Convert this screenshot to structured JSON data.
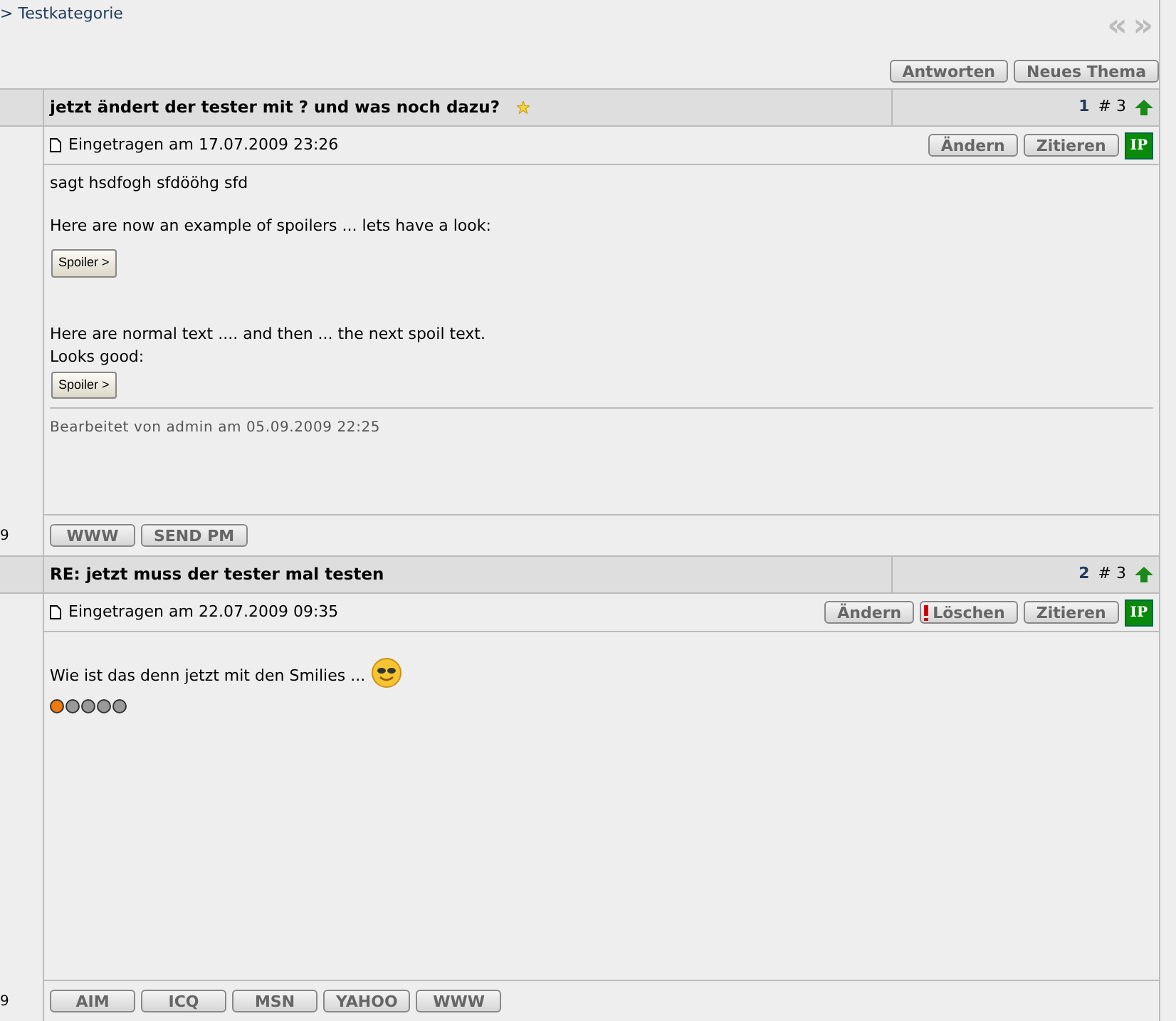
{
  "breadcrumb": "> Testkategorie",
  "nav_arrows": {
    "prev": "«",
    "next": "»"
  },
  "actions": [
    "Antworten",
    "Neues Thema"
  ],
  "posts": [
    {
      "title": "jetzt ändert der tester mit ? und was noch dazu?",
      "starred": true,
      "number": "1",
      "count": "# 3",
      "date": "Eingetragen am 17.07.2009 23:26",
      "author_fragment": "9",
      "buttons": [
        {
          "kind": "edit",
          "label": "Ändern"
        },
        {
          "kind": "quote",
          "label": "Zitieren"
        }
      ],
      "ip": "IP",
      "body": [
        {
          "kind": "text",
          "text": "sagt hsdfogh sfdööhg sfd"
        },
        {
          "kind": "gap"
        },
        {
          "kind": "text",
          "text": "Here are now an example of spoilers ... lets have a look:"
        },
        {
          "kind": "spoiler",
          "label": "Spoiler >"
        },
        {
          "kind": "gap"
        },
        {
          "kind": "gap"
        },
        {
          "kind": "text",
          "text": "Here are normal text .... and then ... the next spoil text."
        },
        {
          "kind": "text",
          "text": "Looks good:"
        },
        {
          "kind": "spoiler",
          "label": "Spoiler >"
        },
        {
          "kind": "edited",
          "text": "Bearbeitet von admin am 05.09.2009 22:25"
        }
      ],
      "contacts": [
        "WWW",
        "SEND PM"
      ]
    },
    {
      "title": "RE: jetzt muss der tester mal testen",
      "starred": false,
      "number": "2",
      "count": "# 3",
      "date": "Eingetragen am 22.07.2009 09:35",
      "author_fragment": "9",
      "buttons": [
        {
          "kind": "edit",
          "label": "Ändern"
        },
        {
          "kind": "delete",
          "label": "Löschen"
        },
        {
          "kind": "quote",
          "label": "Zitieren"
        }
      ],
      "ip": "IP",
      "body": [
        {
          "kind": "gap"
        },
        {
          "kind": "smiley_text",
          "text": "Wie ist das denn jetzt mit den Smilies ..."
        },
        {
          "kind": "rating",
          "stars": 1
        }
      ],
      "contacts": [
        "AIM",
        "ICQ",
        "MSN",
        "YAHOO",
        "WWW"
      ]
    }
  ]
}
